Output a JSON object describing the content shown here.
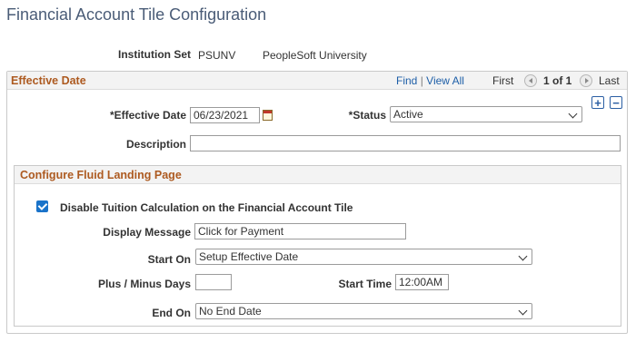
{
  "page": {
    "title": "Financial Account Tile Configuration"
  },
  "institution": {
    "label": "Institution Set",
    "code": "PSUNV",
    "name": "PeopleSoft University"
  },
  "effective_group": {
    "title": "Effective Date",
    "find": "Find",
    "separator": "|",
    "view_all": "View All",
    "first": "First",
    "position": "1 of 1",
    "last": "Last",
    "add_symbol": "+",
    "remove_symbol": "−"
  },
  "fields": {
    "effective_date": {
      "label": "*Effective Date",
      "value": "06/23/2021"
    },
    "status": {
      "label": "*Status",
      "value": "Active"
    },
    "description": {
      "label": "Description",
      "value": ""
    }
  },
  "fluid": {
    "title": "Configure Fluid Landing Page",
    "disable_tuition": {
      "label": "Disable Tuition Calculation on the Financial Account Tile",
      "checked": true
    },
    "display_message": {
      "label": "Display Message",
      "value": "Click for Payment"
    },
    "start_on": {
      "label": "Start On",
      "value": "Setup Effective Date"
    },
    "plus_minus_days": {
      "label": "Plus / Minus Days",
      "value": ""
    },
    "start_time": {
      "label": "Start Time",
      "value": "12:00AM"
    },
    "end_on": {
      "label": "End On",
      "value": "No End Date"
    }
  },
  "colors": {
    "title": "#4a5c77",
    "group_title": "#ad5a20",
    "link": "#1e5fa8",
    "checkbox": "#1a73c9"
  },
  "icons": [
    "calendar-icon",
    "chevron-down-icon",
    "first-arrow-icon",
    "next-arrow-icon",
    "add-row-icon",
    "delete-row-icon",
    "checkbox-checked-icon"
  ]
}
